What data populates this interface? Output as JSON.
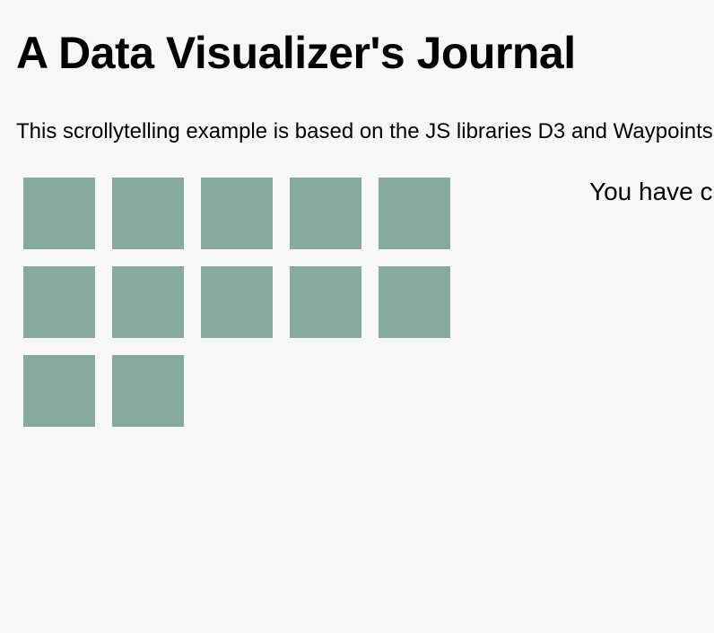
{
  "page": {
    "title": "A Data Visualizer's Journal",
    "intro": "This scrollytelling example is based on the JS libraries D3 and Waypoints."
  },
  "visualization": {
    "square_count": 12,
    "columns": 5,
    "square_color": "#86aa9d"
  },
  "step": {
    "text": "You have c"
  }
}
